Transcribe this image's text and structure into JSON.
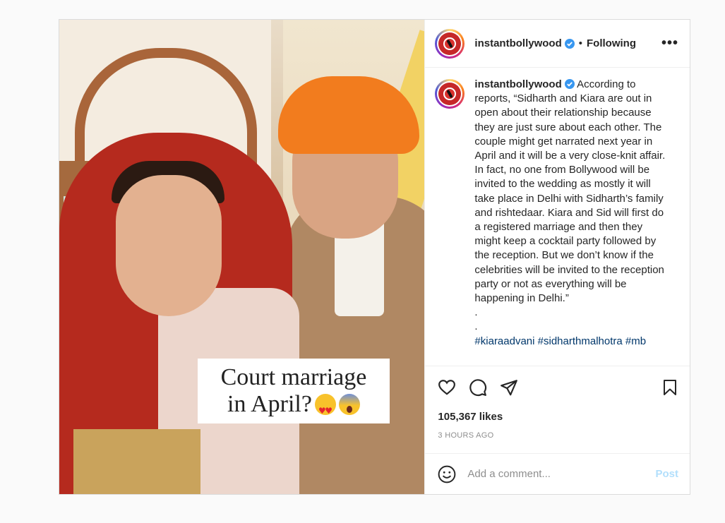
{
  "post": {
    "image": {
      "overlay_line1": "Court marriage",
      "overlay_line2": "in April?"
    },
    "header": {
      "username": "instantbollywood",
      "separator": "•",
      "follow_state": "Following",
      "more_label": "•••"
    },
    "caption": {
      "username": "instantbollywood",
      "text": "According to reports, “Sidharth and Kiara are out in open about their relationship because they are just sure about each other. The couple might get narrated next year in April and it will be a very close-knit affair. In fact, no one from Bollywood will be invited to the wedding as mostly it will take place in Delhi with Sidharth’s family and rishtedaar. Kiara and Sid will first do a registered marriage and then they might keep a cocktail party followed by the reception. But we don’t know if the celebrities will be invited to the reception party or not as everything will be happening in Delhi.”",
      "dot1": ".",
      "dot2": ".",
      "hashtags": "#kiaraadvani #sidharthmalhotra #mb"
    },
    "actions": {
      "likes": "105,367 likes",
      "time_ago": "3 HOURS AGO"
    },
    "comment": {
      "placeholder": "Add a comment...",
      "post_label": "Post"
    },
    "colors": {
      "verified": "#3897f0",
      "post_button_disabled": "#b2dffc",
      "hashtag": "#00376b"
    },
    "icons": [
      "heart-icon",
      "comment-icon",
      "share-icon",
      "bookmark-icon",
      "emoji-icon",
      "verified-badge-icon",
      "more-icon"
    ]
  }
}
